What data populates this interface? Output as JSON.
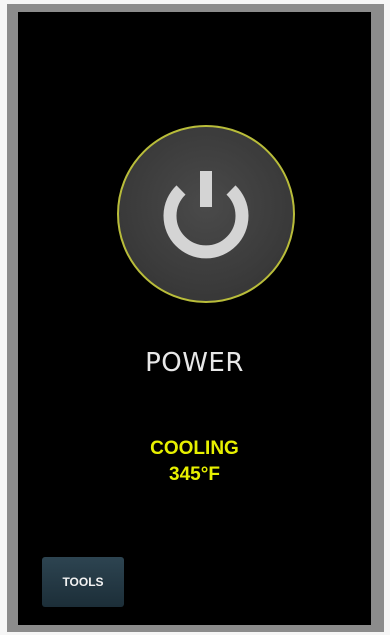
{
  "device": {
    "power_icon": "power-icon",
    "power_label": "POWER",
    "status": {
      "mode": "COOLING",
      "temperature": "345°F"
    },
    "tools_label": "TOOLS"
  },
  "colors": {
    "screen_background": "#000000",
    "bezel": "#8c8c8c",
    "power_ring": "#b9bd3a",
    "power_symbol": "#d4d4d4",
    "status_text": "#e7f000",
    "label_text": "#e8e8e8",
    "tools_button": "#243844"
  }
}
